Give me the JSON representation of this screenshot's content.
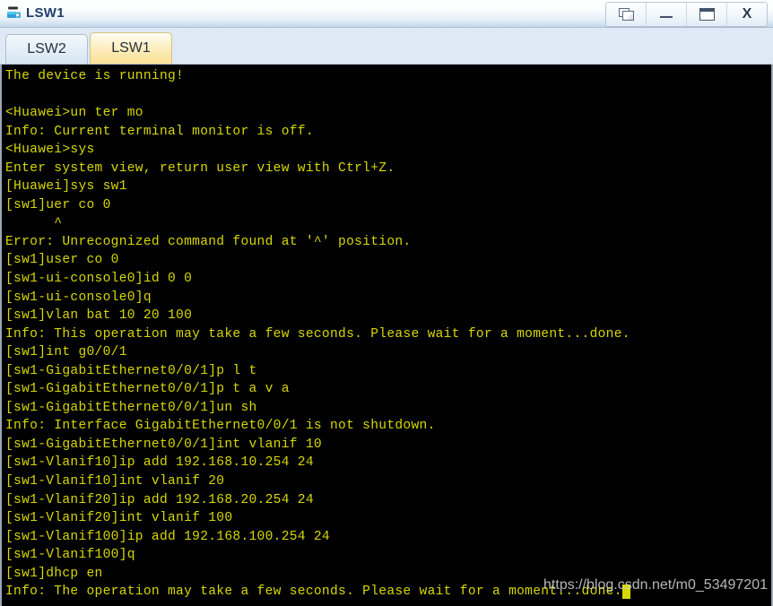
{
  "window": {
    "title": "LSW1",
    "icon": "switch-device-icon",
    "controls": [
      {
        "name": "restore-button",
        "glyph": "restore-icon",
        "label": "Restore"
      },
      {
        "name": "minimize-button",
        "glyph": "minimize-icon",
        "label": "_"
      },
      {
        "name": "maximize-button",
        "glyph": "maximize-icon",
        "label": "Maximize"
      },
      {
        "name": "close-button",
        "glyph": "close-icon",
        "label": "X"
      }
    ]
  },
  "tabs": [
    {
      "label": "LSW2",
      "active": false
    },
    {
      "label": "LSW1",
      "active": true
    }
  ],
  "terminal": {
    "foreground_color": "#d7d700",
    "background_color": "#000000",
    "cursor": "_",
    "lines": [
      "The device is running!",
      "",
      "<Huawei>un ter mo",
      "Info: Current terminal monitor is off.",
      "<Huawei>sys",
      "Enter system view, return user view with Ctrl+Z.",
      "[Huawei]sys sw1",
      "[sw1]uer co 0",
      "      ^",
      "Error: Unrecognized command found at '^' position.",
      "[sw1]user co 0",
      "[sw1-ui-console0]id 0 0",
      "[sw1-ui-console0]q",
      "[sw1]vlan bat 10 20 100",
      "Info: This operation may take a few seconds. Please wait for a moment...done.",
      "[sw1]int g0/0/1",
      "[sw1-GigabitEthernet0/0/1]p l t",
      "[sw1-GigabitEthernet0/0/1]p t a v a",
      "[sw1-GigabitEthernet0/0/1]un sh",
      "Info: Interface GigabitEthernet0/0/1 is not shutdown.",
      "[sw1-GigabitEthernet0/0/1]int vlanif 10",
      "[sw1-Vlanif10]ip add 192.168.10.254 24",
      "[sw1-Vlanif10]int vlanif 20",
      "[sw1-Vlanif20]ip add 192.168.20.254 24",
      "[sw1-Vlanif20]int vlanif 100",
      "[sw1-Vlanif100]ip add 192.168.100.254 24",
      "[sw1-Vlanif100]q",
      "[sw1]dhcp en",
      "Info: The operation may take a few seconds. Please wait for a moment...done."
    ]
  },
  "watermark": {
    "text": "https://blog.csdn.net/m0_53497201"
  }
}
